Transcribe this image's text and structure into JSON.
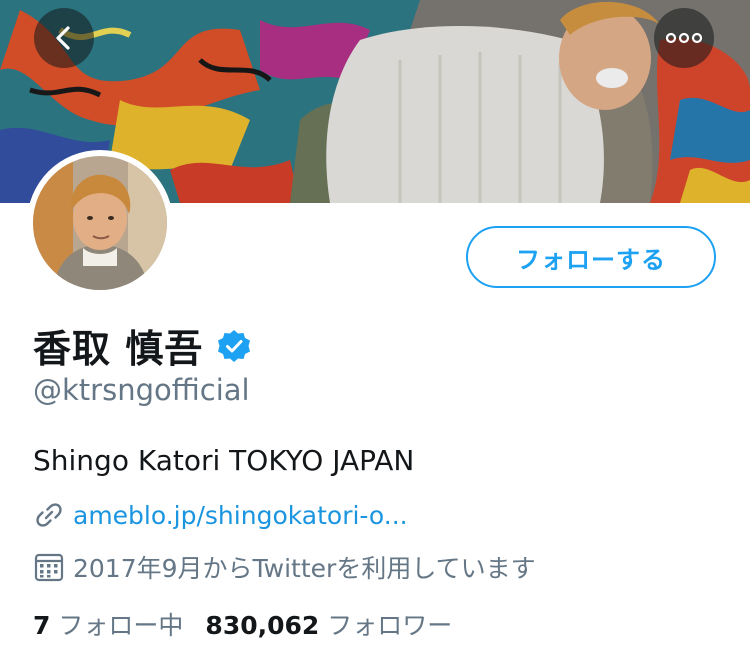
{
  "header": {
    "back_icon": "chevron-left-icon",
    "more_icon": "ellipsis-horizontal-icon"
  },
  "profile": {
    "display_name": "香取 慎吾",
    "verified": true,
    "handle": "@ktrsngofficial",
    "bio": "Shingo Katori TOKYO JAPAN",
    "link_icon": "link-icon",
    "link": "ameblo.jp/shingokatori-o...",
    "joined_icon": "calendar-icon",
    "joined": "2017年9月からTwitterを利用しています"
  },
  "actions": {
    "follow_label": "フォローする"
  },
  "stats": {
    "following_count": "7",
    "following_label": "フォロー中",
    "followers_count": "830,062",
    "followers_label": "フォロワー"
  },
  "colors": {
    "accent": "#1da1f2",
    "link": "#1b95e0",
    "secondary_text": "#657786",
    "primary_text": "#14171a"
  }
}
